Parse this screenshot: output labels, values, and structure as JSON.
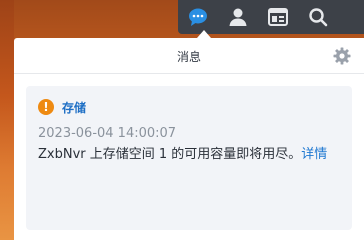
{
  "tray": {
    "icons": [
      "chat-bubble-icon",
      "user-icon",
      "widgets-icon",
      "search-icon"
    ],
    "accent": "#2a8fe3"
  },
  "panel": {
    "title": "消息",
    "settings_icon": "gear-icon"
  },
  "notification": {
    "category": "存储",
    "status_color": "#ee8a12",
    "timestamp": "2023-06-04 14:00:07",
    "message": "ZxbNvr 上存储空间 1 的可用容量即将用尽。",
    "link_label": "详情"
  }
}
